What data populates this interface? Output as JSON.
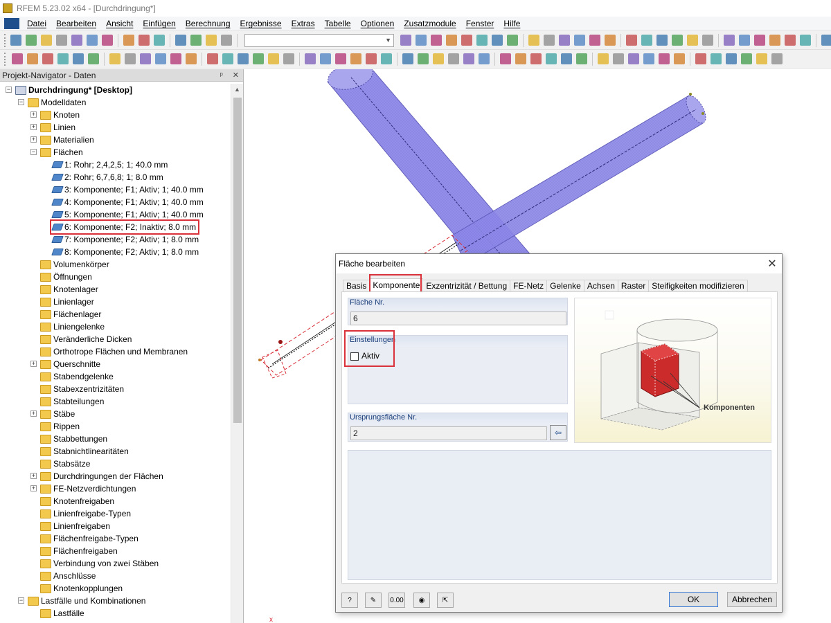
{
  "window": {
    "title": "RFEM 5.23.02 x64 - [Durchdringung*]"
  },
  "menu": [
    "Datei",
    "Bearbeiten",
    "Ansicht",
    "Einfügen",
    "Berechnung",
    "Ergebnisse",
    "Extras",
    "Tabelle",
    "Optionen",
    "Zusatzmodule",
    "Fenster",
    "Hilfe"
  ],
  "navigator": {
    "title": "Projekt-Navigator - Daten",
    "pin": "ᵖ",
    "close": "✕",
    "items": [
      {
        "label": "Durchdringung* [Desktop]",
        "bold": true,
        "depth": 0,
        "expander": "−",
        "icon": "project"
      },
      {
        "label": "Modelldaten",
        "depth": 1,
        "expander": "−",
        "icon": "folder"
      },
      {
        "label": "Knoten",
        "depth": 2,
        "expander": "+",
        "icon": "folder-sub"
      },
      {
        "label": "Linien",
        "depth": 2,
        "expander": "+",
        "icon": "folder-sub"
      },
      {
        "label": "Materialien",
        "depth": 2,
        "expander": "+",
        "icon": "folder-sub"
      },
      {
        "label": "Flächen",
        "depth": 2,
        "expander": "−",
        "icon": "folder-sub"
      },
      {
        "label": "1: Rohr; 2,4,2,5; 1; 40.0 mm",
        "depth": 3,
        "icon": "surface"
      },
      {
        "label": "2: Rohr; 6,7,6,8; 1; 8.0 mm",
        "depth": 3,
        "icon": "surface"
      },
      {
        "label": "3: Komponente; F1; Aktiv; 1; 40.0 mm",
        "depth": 3,
        "icon": "surface"
      },
      {
        "label": "4: Komponente; F1; Aktiv; 1; 40.0 mm",
        "depth": 3,
        "icon": "surface"
      },
      {
        "label": "5: Komponente; F1; Aktiv; 1; 40.0 mm",
        "depth": 3,
        "icon": "surface"
      },
      {
        "label": "6: Komponente; F2; Inaktiv; 8.0 mm",
        "depth": 3,
        "icon": "surface",
        "highlighted": true
      },
      {
        "label": "7: Komponente; F2; Aktiv; 1; 8.0 mm",
        "depth": 3,
        "icon": "surface"
      },
      {
        "label": "8: Komponente; F2; Aktiv; 1; 8.0 mm",
        "depth": 3,
        "icon": "surface"
      },
      {
        "label": "Volumenkörper",
        "depth": 2,
        "icon": "folder-sub"
      },
      {
        "label": "Öffnungen",
        "depth": 2,
        "icon": "folder-sub"
      },
      {
        "label": "Knotenlager",
        "depth": 2,
        "icon": "folder-sub"
      },
      {
        "label": "Linienlager",
        "depth": 2,
        "icon": "folder-sub"
      },
      {
        "label": "Flächenlager",
        "depth": 2,
        "icon": "folder-sub"
      },
      {
        "label": "Liniengelenke",
        "depth": 2,
        "icon": "folder-sub"
      },
      {
        "label": "Veränderliche Dicken",
        "depth": 2,
        "icon": "folder-sub"
      },
      {
        "label": "Orthotrope Flächen und Membranen",
        "depth": 2,
        "icon": "folder-sub"
      },
      {
        "label": "Querschnitte",
        "depth": 2,
        "expander": "+",
        "icon": "folder-sub"
      },
      {
        "label": "Stabendgelenke",
        "depth": 2,
        "icon": "folder-sub"
      },
      {
        "label": "Stabexzentrizitäten",
        "depth": 2,
        "icon": "folder-sub"
      },
      {
        "label": "Stabteilungen",
        "depth": 2,
        "icon": "folder-sub"
      },
      {
        "label": "Stäbe",
        "depth": 2,
        "expander": "+",
        "icon": "folder-sub"
      },
      {
        "label": "Rippen",
        "depth": 2,
        "icon": "folder-sub"
      },
      {
        "label": "Stabbettungen",
        "depth": 2,
        "icon": "folder-sub"
      },
      {
        "label": "Stabnichtlinearitäten",
        "depth": 2,
        "icon": "folder-sub"
      },
      {
        "label": "Stabsätze",
        "depth": 2,
        "icon": "folder-sub"
      },
      {
        "label": "Durchdringungen der Flächen",
        "depth": 2,
        "expander": "+",
        "icon": "folder-sub"
      },
      {
        "label": "FE-Netzverdichtungen",
        "depth": 2,
        "expander": "+",
        "icon": "folder-sub"
      },
      {
        "label": "Knotenfreigaben",
        "depth": 2,
        "icon": "folder"
      },
      {
        "label": "Linienfreigabe-Typen",
        "depth": 2,
        "icon": "folder"
      },
      {
        "label": "Linienfreigaben",
        "depth": 2,
        "icon": "folder"
      },
      {
        "label": "Flächenfreigabe-Typen",
        "depth": 2,
        "icon": "folder-sub"
      },
      {
        "label": "Flächenfreigaben",
        "depth": 2,
        "icon": "folder-sub"
      },
      {
        "label": "Verbindung von zwei Stäben",
        "depth": 2,
        "icon": "folder"
      },
      {
        "label": "Anschlüsse",
        "depth": 2,
        "icon": "folder"
      },
      {
        "label": "Knotenkopplungen",
        "depth": 2,
        "icon": "folder-sub"
      },
      {
        "label": "Lastfälle und Kombinationen",
        "depth": 1,
        "expander": "−",
        "icon": "folder"
      },
      {
        "label": "Lastfälle",
        "depth": 2,
        "icon": "folder"
      }
    ]
  },
  "dialog": {
    "title": "Fläche bearbeiten",
    "close": "✕",
    "tabs": [
      "Basis",
      "Komponente",
      "Exzentrizität / Bettung",
      "FE-Netz",
      "Gelenke",
      "Achsen",
      "Raster",
      "Steifigkeiten modifizieren"
    ],
    "active_tab": "Komponente",
    "surface_no": {
      "label": "Fläche Nr.",
      "value": "6"
    },
    "settings": {
      "label": "Einstellungen",
      "active_label": "Aktiv",
      "active_checked": false
    },
    "origin_surface": {
      "label": "Ursprungsfläche Nr.",
      "value": "2"
    },
    "illustration": {
      "caption": "Komponenten"
    },
    "buttons": {
      "ok": "OK",
      "cancel": "Abbrechen"
    },
    "footer_icons": [
      "help-icon",
      "edit-icon",
      "units-icon",
      "view-icon",
      "pick-icon"
    ],
    "footer_units_text": "0.00"
  },
  "colors": {
    "highlight": "#d9303a",
    "pipe": "#8a86e6",
    "accent": "#1f4e8c"
  }
}
